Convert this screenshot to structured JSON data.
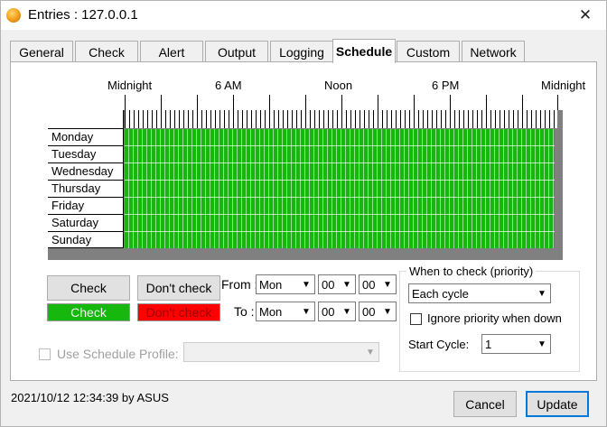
{
  "window": {
    "title": "Entries : 127.0.0.1",
    "close_glyph": "✕"
  },
  "tabs": [
    {
      "label": "General",
      "active": false
    },
    {
      "label": "Check",
      "active": false
    },
    {
      "label": "Alert",
      "active": false
    },
    {
      "label": "Output",
      "active": false
    },
    {
      "label": "Logging",
      "active": false
    },
    {
      "label": "Schedule",
      "active": true
    },
    {
      "label": "Custom",
      "active": false
    },
    {
      "label": "Network",
      "active": false
    }
  ],
  "schedule": {
    "hour_labels": [
      "Midnight",
      "6 AM",
      "Noon",
      "6 PM",
      "Midnight"
    ],
    "days": [
      "Monday",
      "Tuesday",
      "Wednesday",
      "Thursday",
      "Friday",
      "Saturday",
      "Sunday"
    ],
    "grid_state": "all-checked",
    "check_color": "#16b80e",
    "dont_check_color": "#ff0000"
  },
  "controls": {
    "check_button": "Check",
    "dont_check_button": "Don't check",
    "check_swatch": "Check",
    "dont_check_swatch": "Don't check",
    "from_label": "From :",
    "to_label": "To :",
    "from_day": "Mon",
    "from_hour": "00",
    "from_min": "00",
    "to_day": "Mon",
    "to_hour": "00",
    "to_min": "00",
    "use_profile_label": "Use Schedule Profile:",
    "profile_value": ""
  },
  "priority": {
    "group_title": "When to check (priority)",
    "mode": "Each cycle",
    "ignore_label": "Ignore priority when down",
    "ignore_checked": false,
    "start_cycle_label": "Start Cycle:",
    "start_cycle": "1"
  },
  "footer": {
    "status": "2021/10/12 12:34:39 by ASUS",
    "cancel": "Cancel",
    "update": "Update"
  },
  "icons": {
    "app": "orange-orb-icon",
    "dropdown": "▼"
  }
}
